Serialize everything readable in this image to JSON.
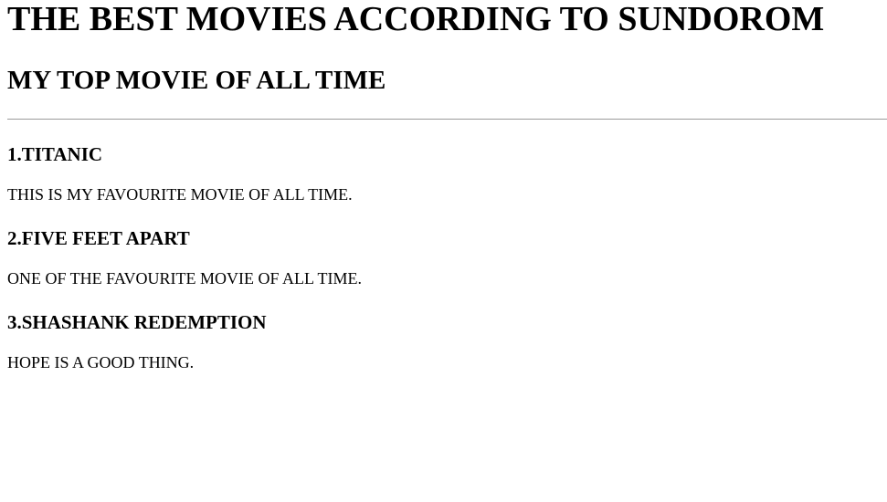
{
  "header": {
    "title": "THE BEST MOVIES ACCORDING TO SUNDOROM"
  },
  "section": {
    "title": "MY TOP MOVIE OF ALL TIME"
  },
  "movies": [
    {
      "title": "1.TITANIC",
      "description": "THIS IS MY FAVOURITE MOVIE OF ALL TIME."
    },
    {
      "title": "2.FIVE FEET APART",
      "description": "ONE OF THE FAVOURITE MOVIE OF ALL TIME."
    },
    {
      "title": "3.SHASHANK REDEMPTION",
      "description": "HOPE IS A GOOD THING."
    }
  ],
  "colors": {
    "text": "#000000",
    "background": "#ffffff",
    "rule": "#9a9a9a"
  }
}
